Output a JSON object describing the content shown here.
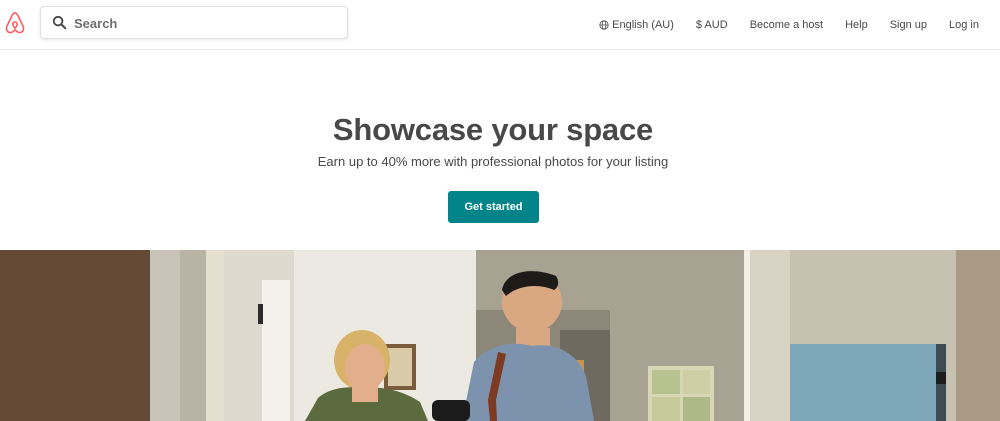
{
  "header": {
    "logo_icon": "airbnb-belo-icon",
    "brand_color": "#FF5A5F",
    "search": {
      "placeholder": "Search",
      "icon": "search-icon"
    },
    "nav": {
      "language_icon": "globe-icon",
      "language": "English (AU)",
      "currency": "$ AUD",
      "become_host": "Become a host",
      "help": "Help",
      "sign_up": "Sign up",
      "log_in": "Log in"
    }
  },
  "hero": {
    "title": "Showcase your space",
    "subtitle": "Earn up to 40% more with professional photos for your listing",
    "cta_label": "Get started",
    "cta_color": "#008489"
  },
  "photo": {
    "description_icon": "hosts-photo-image"
  }
}
